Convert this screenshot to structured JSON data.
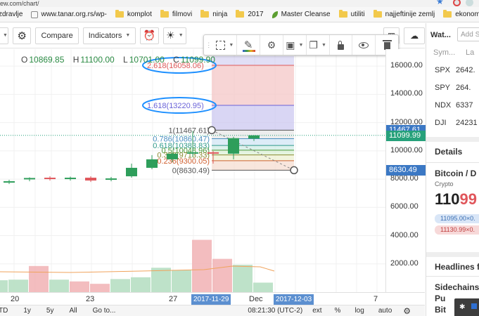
{
  "browser": {
    "url": "ew.com/chart/",
    "bookmarks": [
      {
        "label": "zdravlje",
        "icon": "page-icon"
      },
      {
        "label": "www.tanar.org.rs/wp-",
        "icon": "page-icon"
      },
      {
        "label": "komplot",
        "icon": "folder-icon"
      },
      {
        "label": "filmovi",
        "icon": "folder-icon"
      },
      {
        "label": "ninja",
        "icon": "folder-icon"
      },
      {
        "label": "2017",
        "icon": "folder-icon"
      },
      {
        "label": "Master Cleanse",
        "icon": "leaf-icon"
      },
      {
        "label": "utiliti",
        "icon": "folder-icon"
      },
      {
        "label": "najjeftinije zemlj",
        "icon": "folder-icon"
      },
      {
        "label": "ekonomija",
        "icon": "folder-icon"
      }
    ]
  },
  "toolbar": {
    "compare_label": "Compare",
    "indicators_label": "Indicators"
  },
  "legend": {
    "open_label": "O",
    "open": "10869.85",
    "high_label": "H",
    "high": "11100.00",
    "low_label": "L",
    "low": "10701.00",
    "close_label": "C",
    "close": "11099.90"
  },
  "fib_labels": [
    {
      "level": "2.618(16058.06)",
      "color": "#e05a5a",
      "circled": true
    },
    {
      "level": "1.618(13220.95)",
      "color": "#6a63d8",
      "circled": true
    },
    {
      "level": "1(11467.61)",
      "color": "#555555"
    },
    {
      "level": "0.786(10860.47)",
      "color": "#4a8fc0"
    },
    {
      "level": "0.618(10383.83)",
      "color": "#2f9a8a"
    },
    {
      "level": "0.5(10048.96)",
      "color": "#4c9a3a"
    },
    {
      "level": "0.382(9713.33)",
      "color": "#8a8a30"
    },
    {
      "level": "0.236(9300.05)",
      "color": "#d06030"
    },
    {
      "level": "0(8630.49)",
      "color": "#555555"
    }
  ],
  "price_axis": {
    "ticks": [
      "16000.00",
      "14000.00",
      "12000.00",
      "10000.00",
      "8000.00",
      "6000.00",
      "4000.00",
      "2000.00"
    ],
    "tags": [
      {
        "value": "11467.61",
        "color": "#3b78c4"
      },
      {
        "value": "11099.99",
        "color": "#27a17b"
      },
      {
        "value": "8630.49",
        "color": "#3b78c4"
      }
    ]
  },
  "time_axis": {
    "ticks": [
      "20",
      "23",
      "27",
      "Dec",
      "7"
    ],
    "tags": [
      "2017-11-29",
      "2017-12-03"
    ]
  },
  "bottom_bar": {
    "ranges": [
      "TD",
      "1y",
      "5y",
      "All"
    ],
    "goto": "Go to...",
    "clock": "08:21:30 (UTC-2)",
    "ext": "ext",
    "percent": "%",
    "log": "log",
    "auto": "auto"
  },
  "panel": {
    "watchlist_tab": "Wat...",
    "add_placeholder": "Add S",
    "col_symbol": "Sym...",
    "col_last": "La",
    "rows": [
      {
        "symbol": "SPX",
        "last": "2642."
      },
      {
        "symbol": "SPY",
        "last": "264."
      },
      {
        "symbol": "NDX",
        "last": "6337"
      },
      {
        "symbol": "DJI",
        "last": "24231"
      }
    ],
    "details_title": "Details",
    "instrument": "Bitcoin / D",
    "instrument_type": "Crypto",
    "price_black": "110",
    "price_red": "99",
    "bid": "11095.00×0.",
    "ask": "11130.99×0.",
    "headlines_title": "Headlines fo",
    "headline1": "Sidechains",
    "headline2": "Pu",
    "headline3": "Bit"
  },
  "colors": {
    "up": "#2e9e5b",
    "down": "#e0565b",
    "fib_upper": "#f3c3c3",
    "fib_purple": "#c9c4ef"
  },
  "chart_data": {
    "type": "candlestick",
    "candles": [
      {
        "o": 7780,
        "h": 7950,
        "l": 7650,
        "c": 7850,
        "up": true
      },
      {
        "o": 8000,
        "h": 8130,
        "l": 7850,
        "c": 8080,
        "up": true
      },
      {
        "o": 8100,
        "h": 8200,
        "l": 7900,
        "c": 8000,
        "up": false
      },
      {
        "o": 8000,
        "h": 8180,
        "l": 7900,
        "c": 8100,
        "up": true
      },
      {
        "o": 8100,
        "h": 8200,
        "l": 7800,
        "c": 7900,
        "up": false
      },
      {
        "o": 7950,
        "h": 8150,
        "l": 7850,
        "c": 8050,
        "up": true
      },
      {
        "o": 8200,
        "h": 9100,
        "l": 8100,
        "c": 8800,
        "up": true
      },
      {
        "o": 8800,
        "h": 9700,
        "l": 8700,
        "c": 9400,
        "up": true
      },
      {
        "o": 9400,
        "h": 9900,
        "l": 9200,
        "c": 9800,
        "up": true
      },
      {
        "o": 9800,
        "h": 11400,
        "l": 9600,
        "c": 9900,
        "up": true
      },
      {
        "o": 9900,
        "h": 10000,
        "l": 9100,
        "c": 9900,
        "up": false
      },
      {
        "o": 9800,
        "h": 11000,
        "l": 9400,
        "c": 10900,
        "up": true
      },
      {
        "o": 10870,
        "h": 11100,
        "l": 10701,
        "c": 11100,
        "up": true
      }
    ],
    "volumes": [
      1000,
      1050,
      2200,
      1050,
      900,
      700,
      1100,
      1250,
      2050,
      1850,
      4400,
      2800,
      2300,
      800
    ],
    "volume_up": [
      true,
      true,
      false,
      true,
      false,
      false,
      true,
      true,
      true,
      true,
      false,
      false,
      true,
      true
    ],
    "ylim": [
      0,
      17200
    ],
    "fib_levels": [
      16058.06,
      13220.95,
      11467.61,
      10860.47,
      10383.83,
      10048.96,
      9713.33,
      9300.05,
      8630.49
    ]
  }
}
